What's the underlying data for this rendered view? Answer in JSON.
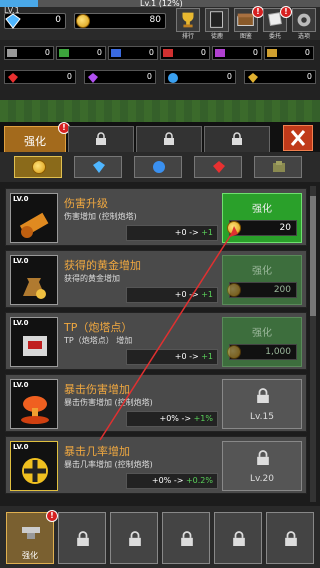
{
  "status": {
    "level": "LV.1",
    "xp_text": "Lv.1 (12%)",
    "xp_progress": 0.12,
    "gems": "0",
    "coins": "80"
  },
  "menu": {
    "items": [
      {
        "label": "排行",
        "icon": "trophy-icon"
      },
      {
        "label": "徒鹿",
        "icon": "book-icon"
      },
      {
        "label": "图鉴",
        "icon": "chest-icon"
      },
      {
        "label": "委托",
        "icon": "scroll-icon"
      },
      {
        "label": "选项",
        "icon": "gear-icon"
      }
    ]
  },
  "resources": {
    "row1": [
      "0",
      "0",
      "0",
      "0",
      "0",
      "0"
    ],
    "row2": [
      "0",
      "0",
      "0",
      "0"
    ]
  },
  "tabs": {
    "active_label": "强化"
  },
  "filters": {
    "items": [
      "coin",
      "diamond",
      "blue-gem",
      "red-gem",
      "block"
    ]
  },
  "upgrades": [
    {
      "level": "LV.0",
      "title": "伤害升级",
      "desc": "伤害增加 (控制炮塔)",
      "delta_from": "+0 -> ",
      "delta_to": "+1",
      "action": "强化",
      "cost": "20",
      "state": "ok"
    },
    {
      "level": "LV.0",
      "title": "获得的黄金增加",
      "desc": "获得的黄金增加",
      "delta_from": "+0 -> ",
      "delta_to": "+1",
      "action": "强化",
      "cost": "200",
      "state": "dis"
    },
    {
      "level": "LV.0",
      "title": "TP（炮塔点）",
      "desc": "TP（炮塔点） 增加",
      "delta_from": "+0 -> ",
      "delta_to": "+1",
      "action": "强化",
      "cost": "1,000",
      "state": "dis"
    },
    {
      "level": "LV.0",
      "title": "暴击伤害增加",
      "desc": "暴击伤害增加 (控制炮塔)",
      "delta_from": "+0% -> ",
      "delta_to": "+1%",
      "action": "",
      "req": "Lv.15",
      "state": "lock"
    },
    {
      "level": "LV.0",
      "title": "暴击几率增加",
      "desc": "暴击几率增加 (控制炮塔)",
      "delta_from": "+0% -> ",
      "delta_to": "+0.2%",
      "action": "",
      "req": "Lv.20",
      "state": "lock"
    }
  ],
  "bottom": {
    "active_label": "强化"
  },
  "colors": {
    "accent": "#2aa02a",
    "title": "#f0a840"
  }
}
